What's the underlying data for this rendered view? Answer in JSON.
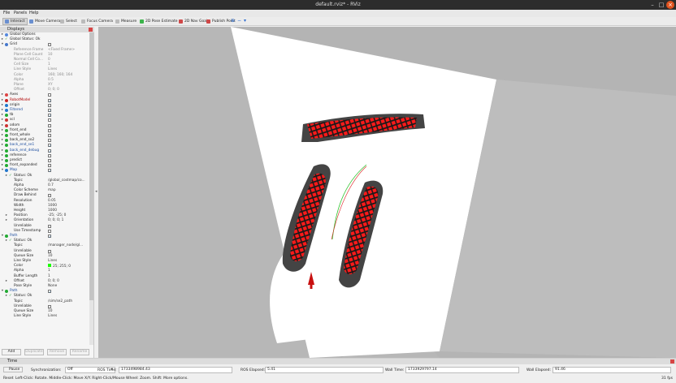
{
  "window": {
    "title": "default.rviz* - RViz"
  },
  "menu": [
    "File",
    "Panels",
    "Help"
  ],
  "toolbar": [
    {
      "label": "Interact",
      "icon": "interact-icon",
      "color": "#6a8fd0",
      "active": true
    },
    {
      "label": "Move Camera",
      "icon": "move-camera-icon",
      "color": "#6a8fd0",
      "active": false
    },
    {
      "label": "Select",
      "icon": "select-icon",
      "color": "#bbbbbb",
      "active": false
    },
    {
      "label": "Focus Camera",
      "icon": "focus-camera-icon",
      "color": "#bbbbbb",
      "active": false
    },
    {
      "label": "Measure",
      "icon": "measure-icon",
      "color": "#bbbbbb",
      "active": false
    },
    {
      "label": "2D Pose Estimate",
      "icon": "pose-estimate-icon",
      "color": "#3cb44b",
      "active": false
    },
    {
      "label": "2D Nav Goal",
      "icon": "nav-goal-icon",
      "color": "#d04848",
      "active": false
    },
    {
      "label": "Publish Point",
      "icon": "publish-point-icon",
      "color": "#d04848",
      "active": false
    }
  ],
  "displays": {
    "title": "Displays",
    "rows": [
      {
        "label": "Global Options",
        "icon": "gear-icon",
        "color": "#5588dd",
        "indent": 0,
        "arrow": "▸"
      },
      {
        "label": "Global Status: Ok",
        "check": "✓",
        "color": "#2a9d3a",
        "indent": 0,
        "arrow": "▸"
      },
      {
        "label": "Grid",
        "icon": "grid-icon",
        "color": "#4477cc",
        "indent": 0,
        "arrow": "▾",
        "box": ""
      },
      {
        "label": "Reference Frame",
        "value": "<Fixed Frame>",
        "indent": 1,
        "sub": true
      },
      {
        "label": "Plane Cell Count",
        "value": "10",
        "indent": 1,
        "sub": true
      },
      {
        "label": "Normal Cell Co...",
        "value": "0",
        "indent": 1,
        "sub": true
      },
      {
        "label": "Cell Size",
        "value": "1",
        "indent": 1,
        "sub": true
      },
      {
        "label": "Line Style",
        "value": "Lines",
        "indent": 1,
        "sub": true
      },
      {
        "label": "Color",
        "value": "160; 160; 164",
        "indent": 1,
        "sub": true
      },
      {
        "label": "Alpha",
        "value": "0.5",
        "indent": 1,
        "sub": true
      },
      {
        "label": "Plane",
        "value": "XY",
        "indent": 1,
        "sub": true
      },
      {
        "label": "Offset",
        "value": "0; 0; 0",
        "indent": 1,
        "sub": true
      },
      {
        "label": "Axes",
        "icon": "axes-icon",
        "color": "#dd4444",
        "indent": 0,
        "arrow": "▸",
        "box": ""
      },
      {
        "label": "RobotModel",
        "icon": "robot-icon",
        "color": "#cc2222",
        "indent": 0,
        "arrow": "▸",
        "box": "✓",
        "style": "red"
      },
      {
        "label": "origin",
        "icon": "tf-icon",
        "color": "#2277cc",
        "indent": 0,
        "arrow": "▸",
        "box": ""
      },
      {
        "label": "Filtered",
        "icon": "tf-icon",
        "color": "#2277cc",
        "indent": 0,
        "arrow": "▸",
        "box": "✓",
        "style": "blue"
      },
      {
        "label": "tb",
        "icon": "marker-icon",
        "color": "#22aa33",
        "indent": 0,
        "arrow": "▸",
        "box": "✓"
      },
      {
        "label": "scl",
        "icon": "laser-icon",
        "color": "#cc3333",
        "indent": 0,
        "arrow": "▸",
        "box": ""
      },
      {
        "label": "odom",
        "icon": "axes-icon",
        "color": "#cc3333",
        "indent": 0,
        "arrow": "▸",
        "box": ""
      },
      {
        "label": "front_end",
        "icon": "marker-icon",
        "color": "#22aa33",
        "indent": 0,
        "arrow": "▸",
        "box": ""
      },
      {
        "label": "front_whole",
        "icon": "marker-icon",
        "color": "#22aa33",
        "indent": 0,
        "arrow": "▸",
        "box": ""
      },
      {
        "label": "back_end_so2",
        "icon": "marker-icon",
        "color": "#22aa33",
        "indent": 0,
        "arrow": "▸",
        "box": ""
      },
      {
        "label": "back_end_se1",
        "icon": "marker-icon",
        "color": "#22aa33",
        "indent": 0,
        "arrow": "▸",
        "box": "✓",
        "style": "blue"
      },
      {
        "label": "back_end_debug",
        "icon": "marker-icon",
        "color": "#22aa33",
        "indent": 0,
        "arrow": "▸",
        "box": "✓",
        "style": "blue"
      },
      {
        "label": "reference",
        "icon": "marker-icon",
        "color": "#22aa33",
        "indent": 0,
        "arrow": "▸",
        "box": ""
      },
      {
        "label": "predict",
        "icon": "marker-icon",
        "color": "#22aa33",
        "indent": 0,
        "arrow": "▸",
        "box": ""
      },
      {
        "label": "front_expanded",
        "icon": "marker-icon",
        "color": "#22aa33",
        "indent": 0,
        "arrow": "▸",
        "box": ""
      },
      {
        "label": "Map",
        "icon": "map-icon",
        "color": "#2277cc",
        "indent": 0,
        "arrow": "▾",
        "box": "✓",
        "style": "blue"
      },
      {
        "label": "Status: Ok",
        "check": "✓",
        "color": "#2a9d3a",
        "indent": 1,
        "arrow": "▸"
      },
      {
        "label": "Topic",
        "value": "/global_costmap/co...",
        "indent": 1
      },
      {
        "label": "Alpha",
        "value": "0.7",
        "indent": 1
      },
      {
        "label": "Color Scheme",
        "value": "map",
        "indent": 1
      },
      {
        "label": "Draw Behind",
        "value": "",
        "indent": 1,
        "box": ""
      },
      {
        "label": "Resolution",
        "value": "0.05",
        "indent": 1
      },
      {
        "label": "Width",
        "value": "1000",
        "indent": 1
      },
      {
        "label": "Height",
        "value": "1000",
        "indent": 1
      },
      {
        "label": "Position",
        "value": "-25; -25; 0",
        "indent": 1,
        "arrow": "▸"
      },
      {
        "label": "Orientation",
        "value": "0; 0; 0; 1",
        "indent": 1,
        "arrow": "▸"
      },
      {
        "label": "Unreliable",
        "value": "",
        "indent": 1,
        "box": ""
      },
      {
        "label": "Use Timestamp",
        "value": "",
        "indent": 1,
        "box": ""
      },
      {
        "label": "Path",
        "icon": "path-icon",
        "color": "#22aa33",
        "indent": 0,
        "arrow": "▾",
        "box": "✓",
        "style": "blue"
      },
      {
        "label": "Status: Ok",
        "check": "✓",
        "color": "#2a9d3a",
        "indent": 1,
        "arrow": "▸"
      },
      {
        "label": "Topic",
        "value": "/manager_node/gl...",
        "indent": 1
      },
      {
        "label": "Unreliable",
        "value": "",
        "indent": 1,
        "box": ""
      },
      {
        "label": "Queue Size",
        "value": "10",
        "indent": 1
      },
      {
        "label": "Line Style",
        "value": "Lines",
        "indent": 1
      },
      {
        "label": "Color",
        "value": "25; 255; 0",
        "indent": 1,
        "swatch": "#19ff00"
      },
      {
        "label": "Alpha",
        "value": "1",
        "indent": 1
      },
      {
        "label": "Buffer Length",
        "value": "1",
        "indent": 1
      },
      {
        "label": "Offset",
        "value": "0; 0; 0",
        "indent": 1,
        "arrow": "▸"
      },
      {
        "label": "Pose Style",
        "value": "None",
        "indent": 1
      },
      {
        "label": "Path",
        "icon": "path-icon",
        "color": "#22aa33",
        "indent": 0,
        "arrow": "▾",
        "box": "✓",
        "style": "blue"
      },
      {
        "label": "Status: Ok",
        "check": "✓",
        "color": "#2a9d3a",
        "indent": 1,
        "arrow": "▸"
      },
      {
        "label": "Topic",
        "value": "/sim/se2_path",
        "indent": 1
      },
      {
        "label": "Unreliable",
        "value": "",
        "indent": 1,
        "box": ""
      },
      {
        "label": "Queue Size",
        "value": "10",
        "indent": 1
      },
      {
        "label": "Line Style",
        "value": "Lines",
        "indent": 1
      }
    ],
    "buttons": {
      "add": "Add",
      "duplicate": "Duplicate",
      "remove": "Remove",
      "rename": "Rename"
    }
  },
  "time": {
    "title": "Time",
    "pause": "Pause",
    "sync_label": "Synchronization:",
    "sync_value": "Off",
    "ros_time_label": "ROS Time:",
    "ros_time": "1733498984.43",
    "ros_elapsed_label": "ROS Elapsed:",
    "ros_elapsed": "5.41",
    "wall_time_label": "Wall Time:",
    "wall_time": "1733929797.14",
    "wall_elapsed_label": "Wall Elapsed:",
    "wall_elapsed": "91.46"
  },
  "status": {
    "reset": "Reset",
    "hint": "Left-Click: Rotate. Middle-Click: Move X/Y. Right-Click/Mouse Wheel: Zoom. Shift: More options.",
    "fps": "31 fps"
  }
}
